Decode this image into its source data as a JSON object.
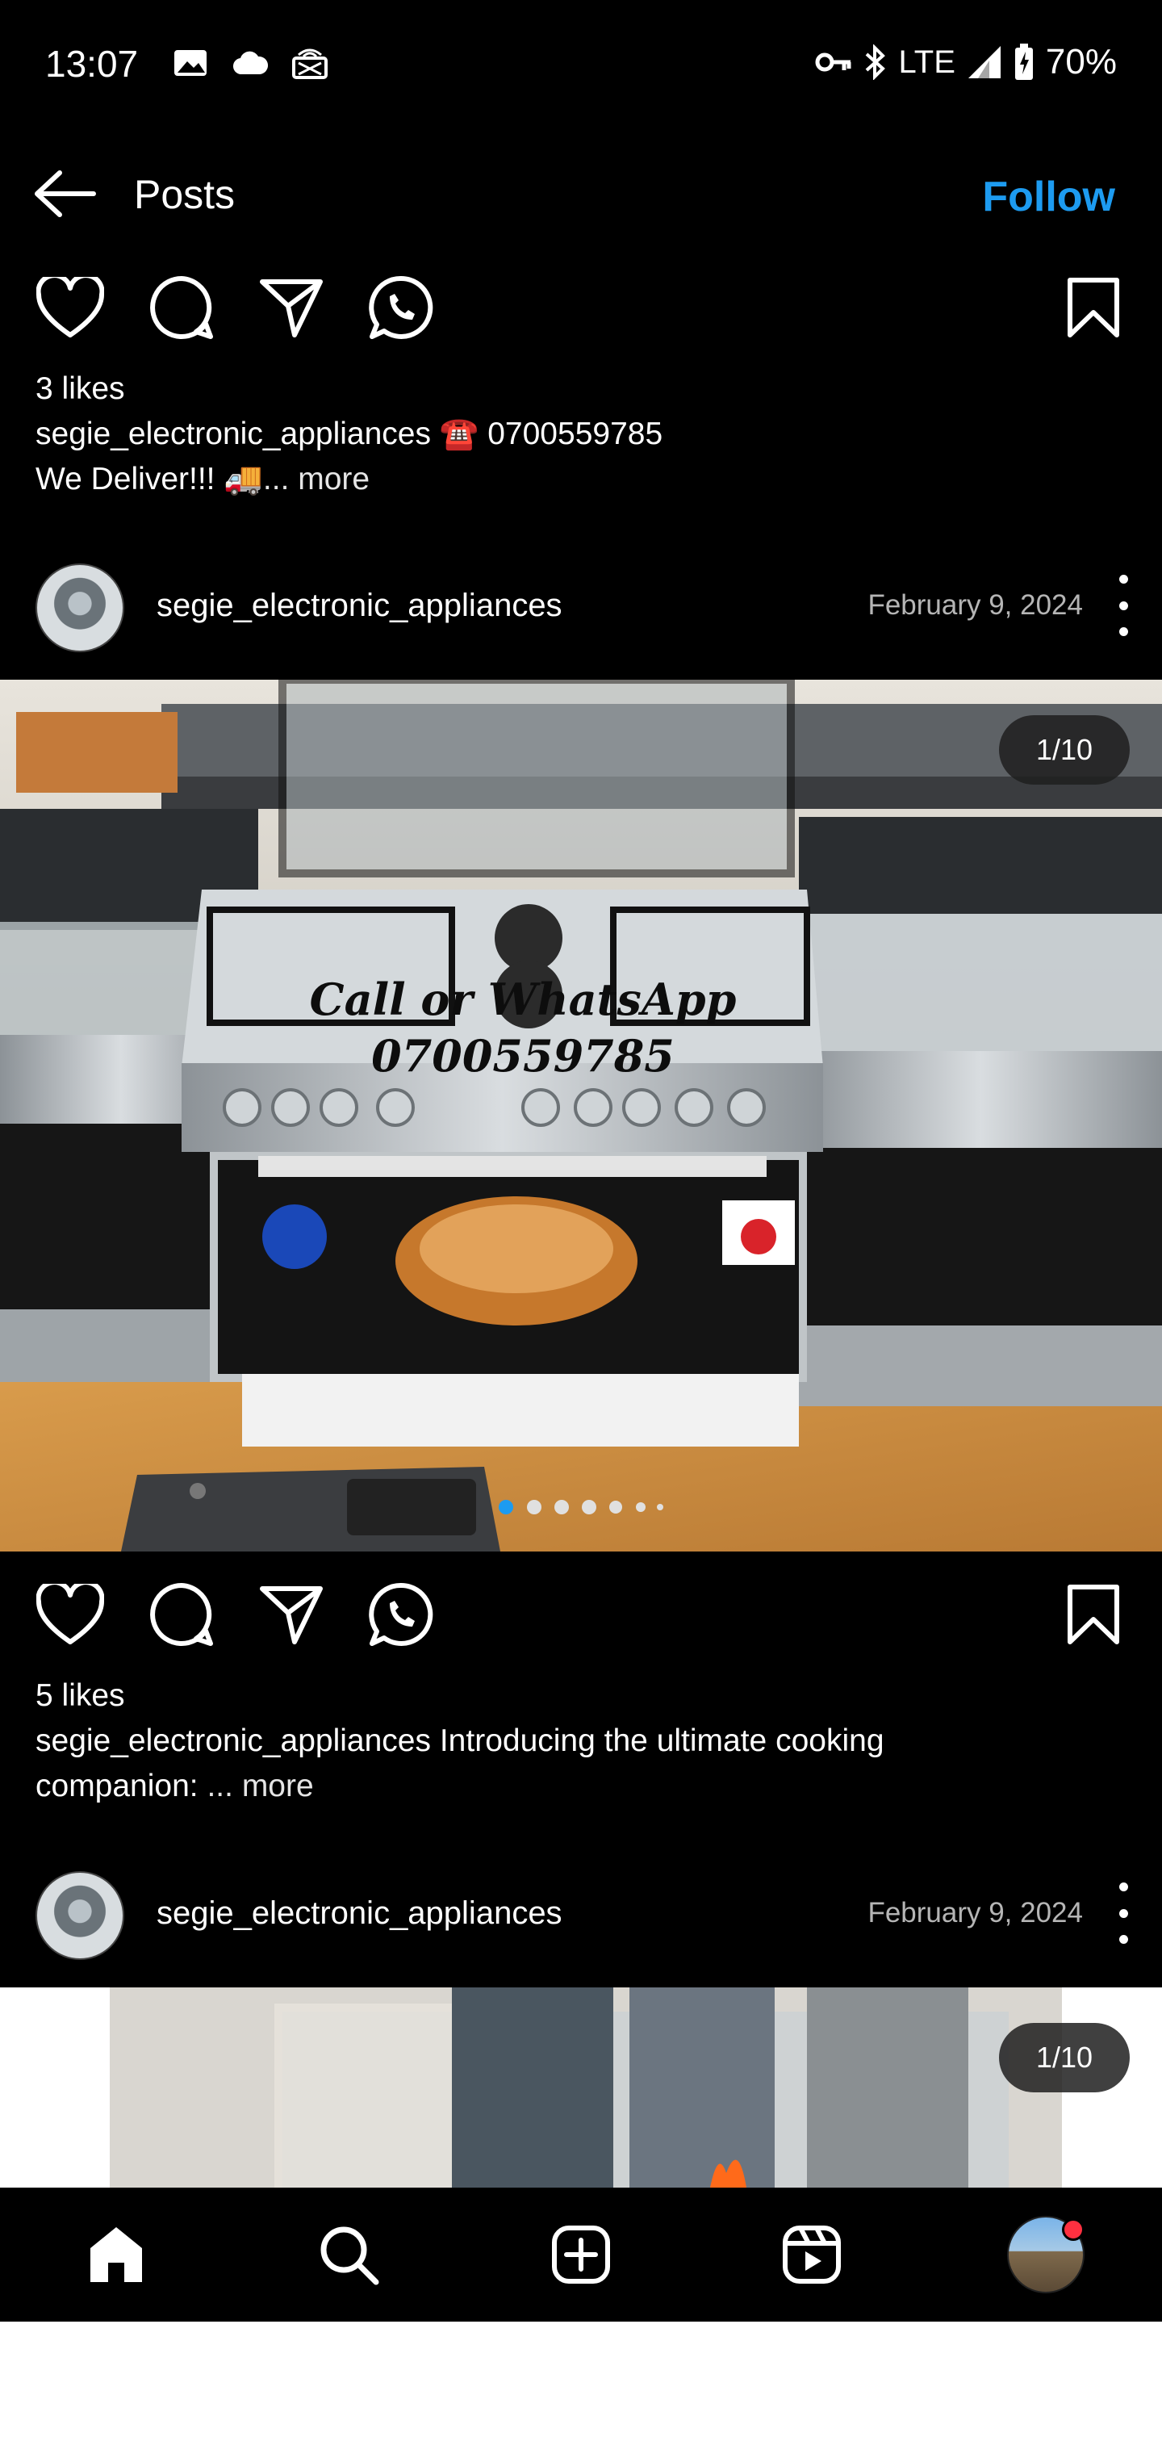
{
  "status_bar": {
    "time": "13:07",
    "network": "LTE",
    "battery": "70%",
    "left_icons": [
      "gallery-icon",
      "cloud-icon",
      "cast-icon"
    ],
    "right_icons": [
      "vpn-key-icon",
      "bluetooth-icon",
      "signal-icon",
      "battery-icon"
    ]
  },
  "header": {
    "title": "Posts",
    "follow_label": "Follow",
    "accent_color": "#1d9bf0"
  },
  "posts": [
    {
      "likes": "3 likes",
      "username": "segie_electronic_appliances",
      "caption": "☎️ 0700559785",
      "caption_line2": "We Deliver!!! 🚚",
      "more": "... more"
    },
    {
      "username": "segie_electronic_appliances",
      "date": "February 9, 2024",
      "counter": "1/10",
      "image_overlay_line1": "Call or WhatsApp",
      "image_overlay_line2": "0700559785",
      "carousel_dots": 6,
      "carousel_active": 1,
      "likes": "5 likes",
      "caption": "Introducing the ultimate cooking",
      "caption_line2": "companion:",
      "more": " ... more"
    },
    {
      "username": "segie_electronic_appliances",
      "date": "February 9, 2024",
      "counter": "1/10"
    }
  ],
  "bottom_nav": [
    "home-icon",
    "search-icon",
    "create-icon",
    "reels-icon",
    "profile-avatar"
  ]
}
